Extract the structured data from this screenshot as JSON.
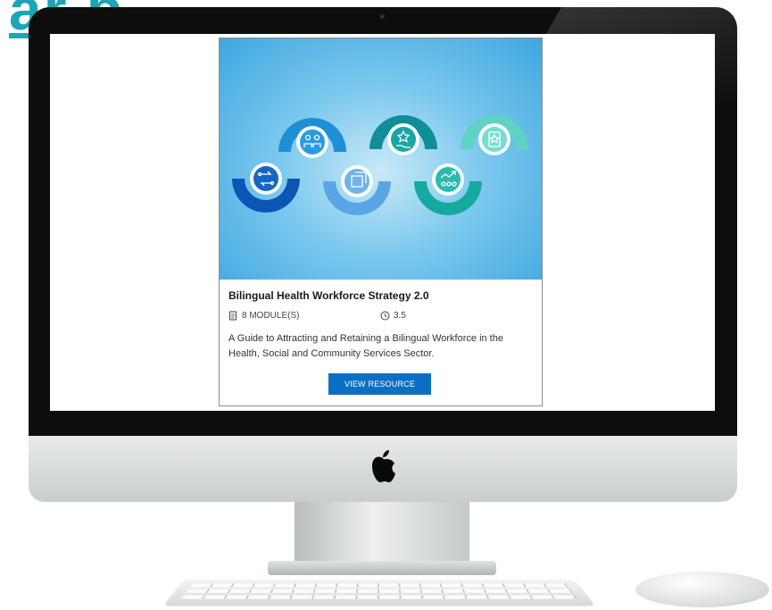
{
  "background_text": "ar    p",
  "card": {
    "title": "Bilingual Health Workforce Strategy 2.0",
    "modules": "8 MODULE(S)",
    "duration": "3.5",
    "description": "A Guide to Attracting and Retaining a Bilingual Workforce in the Health, Social and Community Services Sector.",
    "button_label": "VIEW RESOURCE"
  },
  "icons": [
    "routes-icon",
    "people-icon",
    "frame-icon",
    "hand-star-icon",
    "growth-icon",
    "badge-icon"
  ],
  "colors": {
    "button": "#0a6fc4",
    "accent_teal": "#1aa6b7",
    "image_blue": "#3ea7e0"
  }
}
